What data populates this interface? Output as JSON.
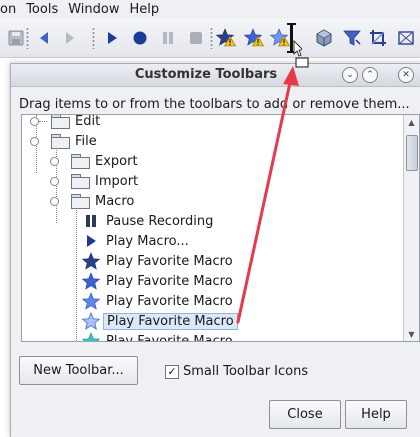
{
  "menubar": {
    "items": [
      {
        "label": "on"
      },
      {
        "label": "Tools"
      },
      {
        "label": "Window"
      },
      {
        "label": "Help"
      }
    ]
  },
  "toolbar": {
    "buttons": [
      {
        "icon": "save-icon"
      },
      {
        "icon": "back-icon"
      },
      {
        "icon": "forward-icon"
      },
      {
        "icon": "play-icon"
      },
      {
        "icon": "record-icon"
      },
      {
        "icon": "pause-icon"
      },
      {
        "icon": "stop-icon"
      },
      {
        "icon": "macro-warning-icon"
      },
      {
        "icon": "favorite-macro-warning-icon"
      },
      {
        "icon": "favorite-macro-warning-icon"
      },
      {
        "icon": "drag-cursor-icon"
      },
      {
        "icon": "cube-gear-icon"
      },
      {
        "icon": "filter-icon"
      },
      {
        "icon": "crop-icon"
      },
      {
        "icon": "overflow-icon"
      }
    ]
  },
  "dialog": {
    "title": "Customize Toolbars",
    "title_buttons": [
      "minimize",
      "maximize",
      "close"
    ],
    "instructions": "Drag items to or from the toolbars to add or remove them...",
    "tree": [
      {
        "label": "Edit",
        "type": "folder"
      },
      {
        "label": "File",
        "type": "folder"
      },
      {
        "label": "Export",
        "type": "folder"
      },
      {
        "label": "Import",
        "type": "folder"
      },
      {
        "label": "Macro",
        "type": "folder"
      },
      {
        "label": "Pause Recording",
        "type": "item",
        "icon": "pause-icon"
      },
      {
        "label": "Play Macro...",
        "type": "item",
        "icon": "play-icon"
      },
      {
        "label": "Play Favorite Macro",
        "type": "item",
        "icon": "star-dark-icon"
      },
      {
        "label": "Play Favorite Macro",
        "type": "item",
        "icon": "star-blue-icon"
      },
      {
        "label": "Play Favorite Macro",
        "type": "item",
        "icon": "star-blue-icon"
      },
      {
        "label": "Play Favorite Macro",
        "type": "item",
        "icon": "star-light-icon",
        "selected": true
      },
      {
        "label": "Play Favorite Macro",
        "type": "item",
        "icon": "star-teal-icon"
      }
    ],
    "new_toolbar_label": "New Toolbar...",
    "small_icons_label": "Small Toolbar Icons",
    "small_icons_checked": true,
    "close_label": "Close",
    "help_label": "Help"
  },
  "colors": {
    "accent_arrow": "#e8394a",
    "selection": "#dce8f7",
    "icon_blue": "#2b4fb0"
  }
}
